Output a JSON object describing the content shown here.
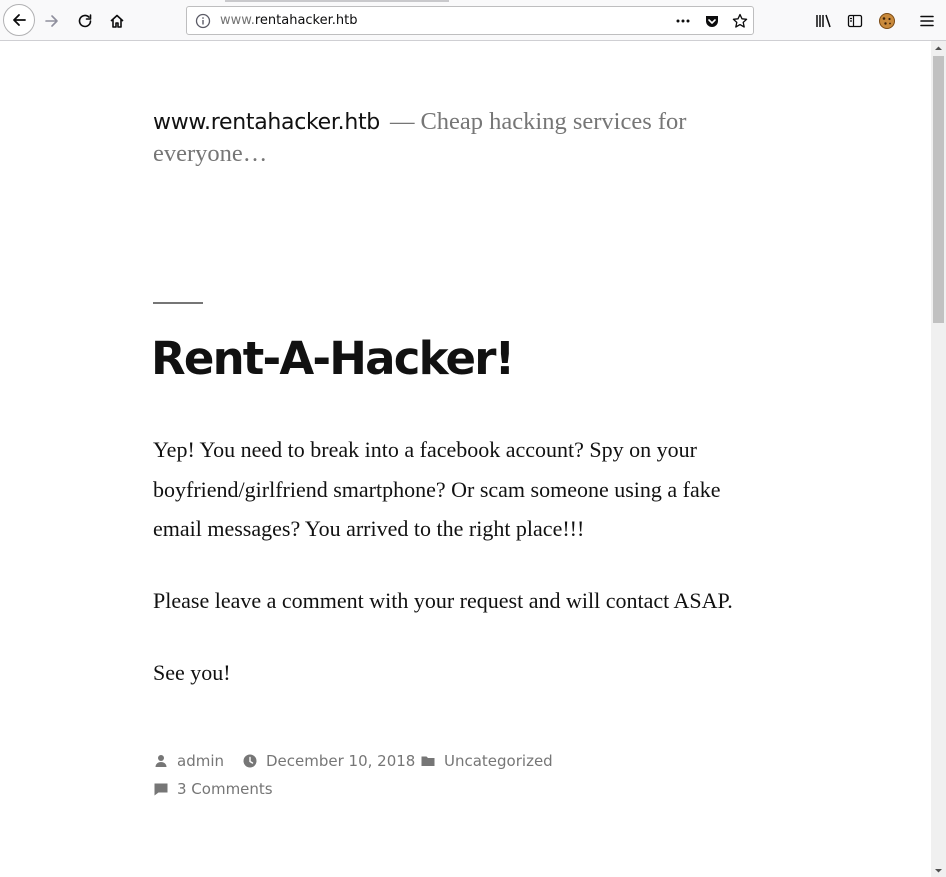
{
  "browser": {
    "url_host": "www.",
    "url_domain": "rentahacker.htb"
  },
  "site": {
    "title": "www.rentahacker.htb",
    "separator": "—",
    "tagline": "Cheap hacking services for everyone…"
  },
  "post": {
    "title": "Rent-A-Hacker!",
    "paragraphs": [
      "Yep! You need to break into a facebook account? Spy on your boyfriend/girlfriend smartphone? Or scam someone using a fake email messages? You arrived to the right place!!!",
      "Please leave a comment with your request and will contact ASAP.",
      "See you!"
    ],
    "meta": {
      "author": "admin",
      "date": "December 10, 2018",
      "category": "Uncategorized",
      "comments": "3 Comments"
    }
  },
  "icons": {
    "back": "back-arrow-icon",
    "forward": "forward-arrow-icon",
    "reload": "reload-icon",
    "home": "home-icon",
    "info": "info-icon",
    "more": "more-icon",
    "pocket": "pocket-icon",
    "bookmark": "star-icon",
    "library": "library-icon",
    "sidebar": "sidebar-icon",
    "cookie": "cookie-icon",
    "menu": "hamburger-menu-icon"
  }
}
